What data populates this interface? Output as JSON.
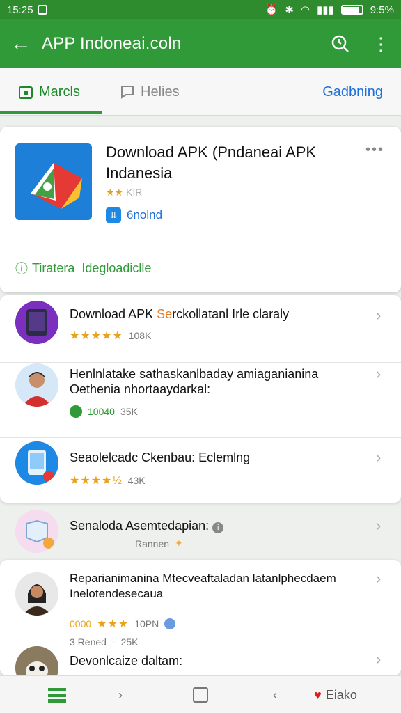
{
  "status_bar": {
    "time": "15:25",
    "battery_text": "9:5%",
    "battery_level": 0.85
  },
  "app_bar": {
    "title": "APP Indoneai.coln"
  },
  "tabs": [
    {
      "label": "Marcls",
      "active": true
    },
    {
      "label": "Helies",
      "active": false
    },
    {
      "label": "Gadbning",
      "active": false
    }
  ],
  "featured": {
    "title": "Download APK (Pndaneai APK Indanesia",
    "rating_text": "K!R",
    "badge_label": "6nolnd",
    "footer_prefix": "Tiratera",
    "footer_link": "Idegloadiclle"
  },
  "list": [
    {
      "title_before": "Download APK ",
      "title_highlight": "Se",
      "title_after": "rckollatanl Irle claraly",
      "meta": "108K",
      "stars": "★★★★★",
      "badge": ""
    },
    {
      "title_before": "Henlnlatake sathaskanlbaday amiaganianina Oethenia nhortaaydarkal:",
      "title_highlight": "",
      "title_after": "",
      "meta": "35K",
      "stars": "",
      "badge": "10040"
    },
    {
      "title_before": "Seaolelcadc Ckenbau: Eclemlng",
      "title_highlight": "",
      "title_after": "",
      "meta": "43K",
      "stars": "★★★★½",
      "badge": ""
    }
  ],
  "list2": [
    {
      "title": "Senaloda Asemtedapian:",
      "subtitle": "Rannen"
    },
    {
      "title": "Reparianimanina Mtecveaftaladan latanlphecdaem Inelotendesecaua",
      "meta1": "10PN",
      "meta2_prefix": "3 Rened",
      "meta2_value": "25K",
      "rating_prefix": "0000"
    },
    {
      "title": "Devonlcaize daltam:"
    }
  ],
  "nav": {
    "last_label": "Eiako"
  },
  "colors": {
    "primary": "#2f9a37",
    "accent_blue": "#1e6fd9",
    "star": "#e9a21b"
  }
}
